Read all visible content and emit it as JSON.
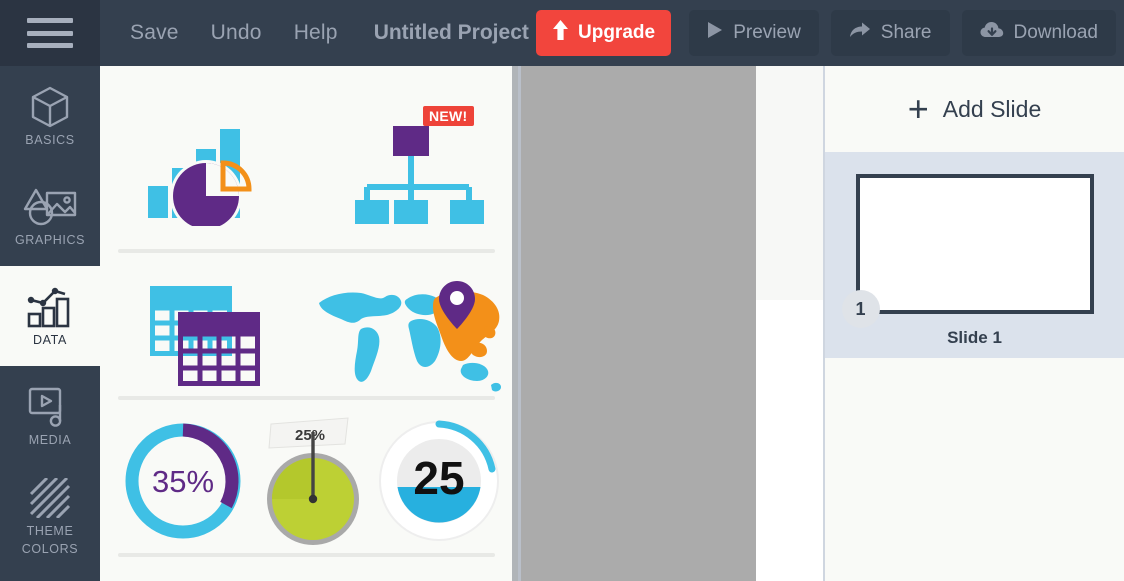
{
  "toolbar": {
    "menu_icon": "hamburger-icon",
    "save_label": "Save",
    "undo_label": "Undo",
    "help_label": "Help",
    "project_title": "Untitled Project",
    "upgrade_label": "Upgrade",
    "upgrade_icon": "upload-arrow-icon",
    "upgrade_color": "#f2453d",
    "preview_label": "Preview",
    "preview_icon": "play-icon",
    "share_label": "Share",
    "share_icon": "share-arrow-icon",
    "download_label": "Download",
    "download_icon": "cloud-download-icon",
    "bar_color": "#34404f",
    "text_color": "#9aa3b2"
  },
  "sidebar": {
    "items": [
      {
        "label": "BASICS",
        "icon": "cube-icon",
        "active": false
      },
      {
        "label": "GRAPHICS",
        "icon": "shapes-image-icon",
        "active": false
      },
      {
        "label": "DATA",
        "icon": "chart-bars-icon",
        "active": true
      },
      {
        "label": "MEDIA",
        "icon": "video-note-icon",
        "active": false
      },
      {
        "label": "THEME COLORS",
        "label_line1": "THEME",
        "label_line2": "COLORS",
        "icon": "diagonal-stripes-icon",
        "active": false
      }
    ]
  },
  "panel": {
    "name": "data-widgets-panel",
    "rows": [
      {
        "items": [
          {
            "name": "charts-widget",
            "icon": "bar-pie-chart-icon",
            "badge": null
          },
          {
            "name": "org-chart-widget",
            "icon": "org-chart-icon",
            "badge": "NEW!"
          }
        ]
      },
      {
        "items": [
          {
            "name": "table-widget",
            "icon": "table-icon",
            "badge": null
          },
          {
            "name": "map-widget",
            "icon": "world-map-pin-icon",
            "badge": null
          }
        ]
      },
      {
        "items": [
          {
            "name": "donut-gauge-widget",
            "icon": "donut-gauge-icon",
            "value": "35%"
          },
          {
            "name": "speedometer-gauge-widget",
            "icon": "speedometer-gauge-icon",
            "value": "25%"
          },
          {
            "name": "fill-gauge-widget",
            "icon": "fill-gauge-icon",
            "value": "25"
          }
        ]
      }
    ],
    "colors": {
      "cyan": "#3fc0e5",
      "purple": "#5f2a86",
      "orange": "#f39019",
      "red": "#ee4339",
      "green": "#bdd034",
      "background": "#f9faf7"
    }
  },
  "canvas": {
    "name": "slide-canvas",
    "background": "#ababab"
  },
  "slides": {
    "add_slide_label": "Add Slide",
    "add_slide_icon": "plus-icon",
    "list": [
      {
        "number": "1",
        "caption": "Slide 1",
        "selected": true
      }
    ]
  }
}
